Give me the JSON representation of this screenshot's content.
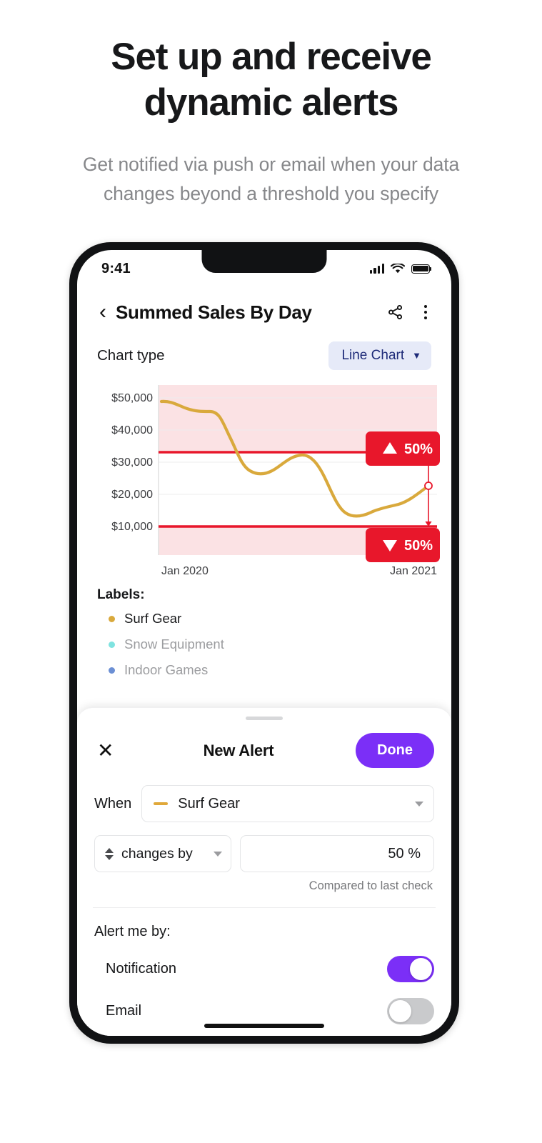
{
  "hero": {
    "headline_line1": "Set up and receive",
    "headline_line2": "dynamic alerts",
    "sub_line1": "Get notified via push or email when your data",
    "sub_line2": "changes beyond a threshold you specify"
  },
  "status_bar": {
    "time": "9:41",
    "signal_icon": "cellular-signal-icon",
    "wifi_icon": "wifi-icon",
    "battery_icon": "battery-full-icon"
  },
  "nav": {
    "back_icon": "chevron-left-icon",
    "title": "Summed Sales By Day",
    "share_icon": "share-icon",
    "more_icon": "kebab-menu-icon"
  },
  "chart_type": {
    "label": "Chart type",
    "selected": "Line Chart",
    "chevron": "⌄"
  },
  "legend": {
    "title": "Labels:",
    "items": [
      {
        "label": "Surf Gear",
        "color": "#d9a93c",
        "active": true
      },
      {
        "label": "Snow Equipment",
        "color": "#7fe3e0",
        "active": false
      },
      {
        "label": "Indoor Games",
        "color": "#6b8fd4",
        "active": false
      }
    ]
  },
  "alerts": {
    "upper_badge": "50%",
    "upper_arrow": "▲",
    "lower_badge": "50%",
    "lower_arrow": "▼",
    "band_color": "#e8172b",
    "band_fill": "#fbe2e4"
  },
  "sheet": {
    "title": "New Alert",
    "close_label": "✕",
    "done_label": "Done",
    "when_label": "When",
    "series_selected": "Surf Gear",
    "series_color": "#e0a83a",
    "condition_selected": "changes by",
    "value": "50 %",
    "helper": "Compared to last check",
    "alert_by_label": "Alert me by:",
    "toggles": [
      {
        "label": "Notification",
        "on": true
      },
      {
        "label": "Email",
        "on": false
      }
    ]
  },
  "colors": {
    "accent_purple": "#7b2ff7",
    "alert_red": "#e8172b",
    "series_gold": "#d9a93c",
    "pill_bg": "#e6eaf8",
    "pill_text": "#1d2a78"
  },
  "chart_data": {
    "type": "line",
    "title": "Summed Sales By Day",
    "xlabel": "",
    "ylabel": "",
    "x_tick_labels": [
      "Jan 2020",
      "Jan 2021"
    ],
    "y_tick_labels": [
      "$50,000",
      "$40,000",
      "$30,000",
      "$20,000",
      "$10,000"
    ],
    "ylim": [
      5000,
      55000
    ],
    "grid": true,
    "legend_position": "below",
    "series": [
      {
        "name": "Surf Gear",
        "color": "#d9a93c",
        "x": [
          0,
          1,
          2,
          3,
          4,
          5,
          6,
          7,
          8,
          9,
          10,
          11,
          12
        ],
        "values": [
          48800,
          47000,
          45900,
          45600,
          38000,
          28600,
          27900,
          30200,
          31600,
          22000,
          15200,
          14800,
          16400
        ],
        "x_extra": [
          13,
          14,
          15
        ],
        "values_extra": [
          17200,
          17600,
          22200
        ],
        "end_marker_value": 22200
      }
    ],
    "threshold_bands": [
      {
        "name": "upper",
        "value": 33500,
        "label": "50%",
        "direction": "up",
        "color": "#e8172b"
      },
      {
        "name": "lower",
        "value": 11000,
        "label": "50%",
        "direction": "down",
        "color": "#e8172b"
      }
    ]
  }
}
